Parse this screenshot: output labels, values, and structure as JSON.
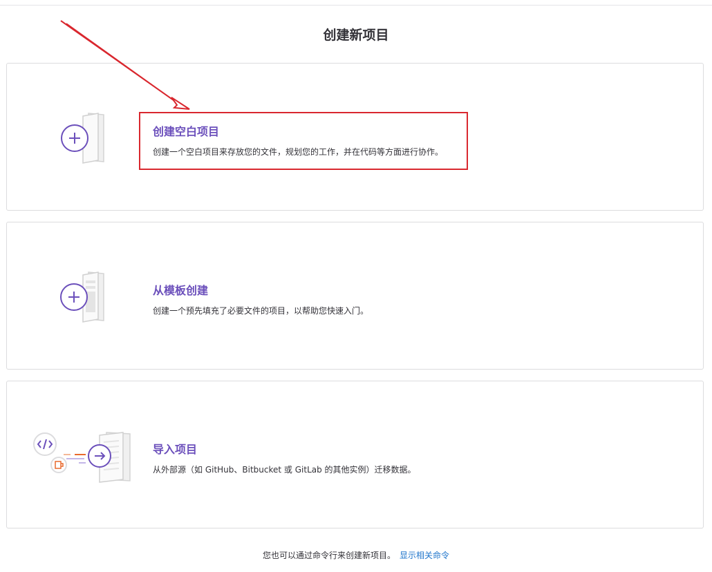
{
  "page": {
    "title": "创建新项目"
  },
  "cards": [
    {
      "title": "创建空白项目",
      "description": "创建一个空白项目来存放您的文件，规划您的工作，并在代码等方面进行协作。",
      "icon": "plus-icon"
    },
    {
      "title": "从模板创建",
      "description": "创建一个预先填充了必要文件的项目，以帮助您快速入门。",
      "icon": "plus-icon"
    },
    {
      "title": "导入项目",
      "description": "从外部源（如 GitHub、Bitbucket 或 GitLab 的其他实例）迁移数据。",
      "icon": "arrow-right-icon"
    }
  ],
  "footer": {
    "text": "您也可以通过命令行来创建新项目。",
    "link": "显示相关命令"
  },
  "colors": {
    "accent": "#6b4fbb",
    "link": "#1f75cb",
    "annotation": "#d9272e"
  }
}
